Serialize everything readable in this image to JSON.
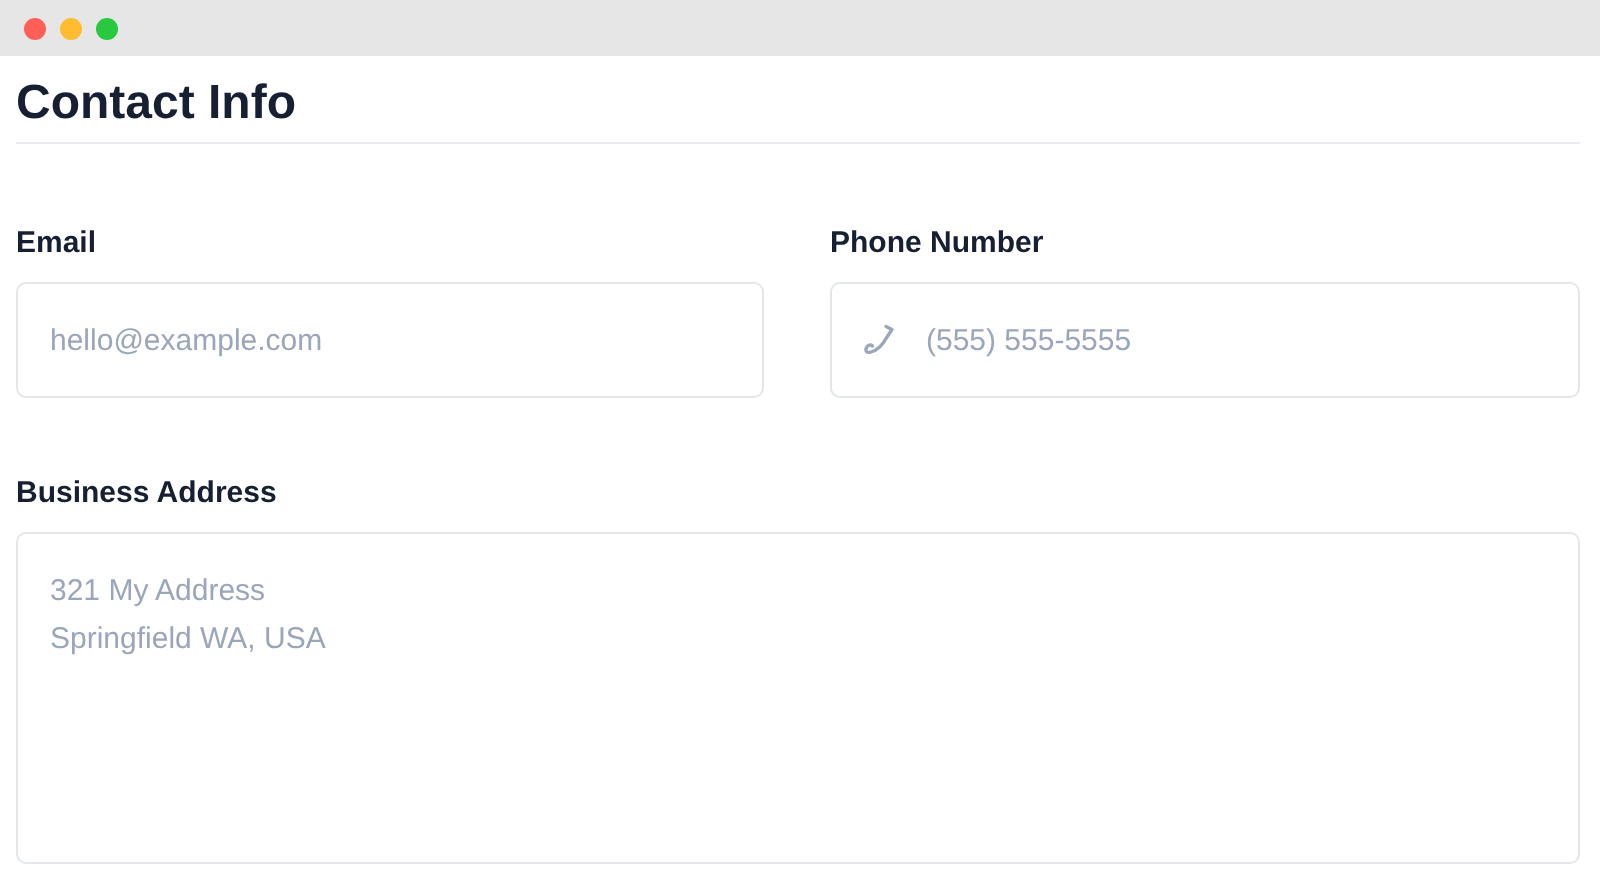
{
  "window": {
    "controls": [
      {
        "color": "#ff5f57"
      },
      {
        "color": "#febc2e"
      },
      {
        "color": "#28c840"
      }
    ]
  },
  "heading": "Contact Info",
  "fields": [
    {
      "kind": "email",
      "label": "Email",
      "placeholder": "hello@example.com"
    },
    {
      "kind": "phone",
      "label": "Phone Number",
      "placeholder": "(555) 555-5555"
    }
  ],
  "address": {
    "label": "Business Address",
    "placeholder": "321 My Address\nSpringfield WA, USA"
  }
}
